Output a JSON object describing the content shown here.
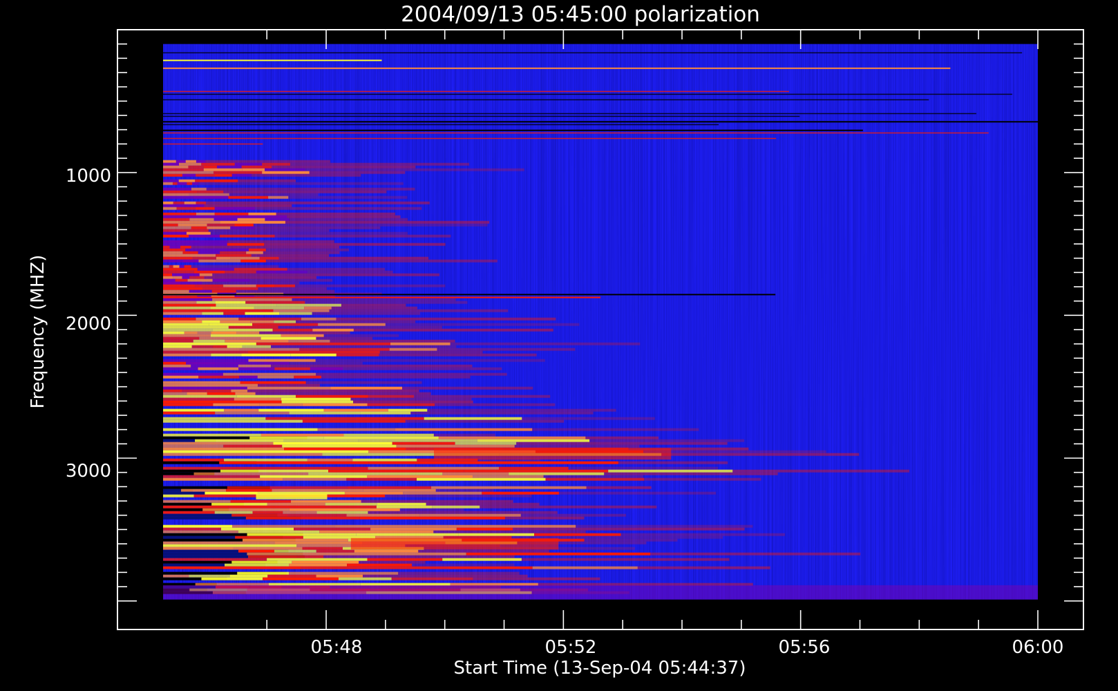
{
  "chart_data": {
    "type": "heatmap",
    "title": "2004/09/13 05:45:00 polarization",
    "xlabel": "Start Time (13-Sep-04 05:44:37)",
    "ylabel": "Frequency (MHZ)",
    "x_tick_labels": [
      "05:48",
      "05:52",
      "05:56",
      "06:00"
    ],
    "x_tick_values_min": [
      3.383,
      7.383,
      11.383,
      15.383
    ],
    "x_data_range_min": [
      0.633,
      15.383
    ],
    "y_tick_labels": [
      "1000",
      "2000",
      "3000"
    ],
    "y_tick_values": [
      1000,
      2000,
      3000
    ],
    "ylim": [
      4200,
      0
    ],
    "y_data_range": [
      100,
      3990
    ],
    "colormap": [
      "#000000",
      "#1e00ff",
      "#7a00b0",
      "#ff1a00",
      "#ff8a3a",
      "#ffff33"
    ],
    "background_color": "#1e1ef5",
    "features": [
      {
        "freq_range": [
          100,
          900
        ],
        "description": "interference lines",
        "intensity": "mixed"
      },
      {
        "freq_range": [
          1700,
          1800
        ],
        "description": "bright band",
        "intensity": "high",
        "time_end_min": 1.5
      },
      {
        "freq_range": [
          2000,
          2200
        ],
        "description": "emission band",
        "intensity": "high",
        "time_end_min": 3.0
      },
      {
        "freq_range": [
          2550,
          3100
        ],
        "description": "drifting emission",
        "intensity": "high",
        "time_end_min": 9.0
      },
      {
        "freq_range": [
          3100,
          3900
        ],
        "description": "emission bands",
        "intensity": "high",
        "time_end_min": 8.0
      }
    ]
  }
}
